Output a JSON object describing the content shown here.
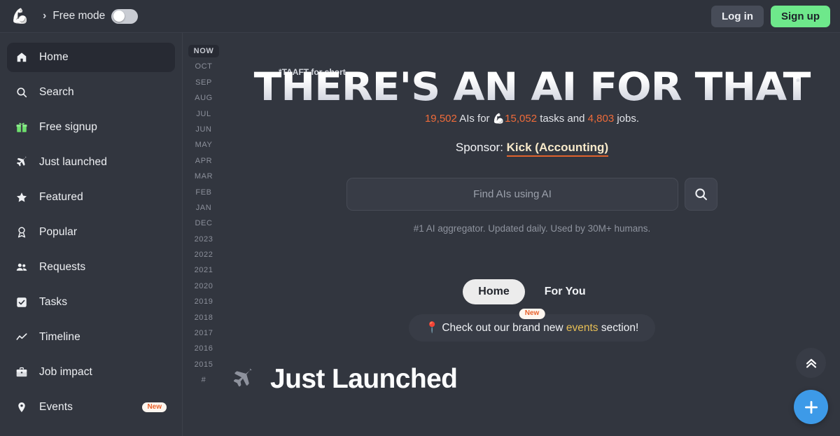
{
  "topbar": {
    "logo_icon": "flexed-biceps-emoji",
    "chevron": "›",
    "free_mode_label": "Free mode",
    "free_mode_on": false,
    "login_label": "Log in",
    "signup_label": "Sign up",
    "signup_color": "#6ee88b"
  },
  "sidebar": {
    "items": [
      {
        "label": "Home",
        "icon": "home-icon",
        "active": true,
        "badge": ""
      },
      {
        "label": "Search",
        "icon": "search-icon",
        "active": false,
        "badge": ""
      },
      {
        "label": "Free signup",
        "icon": "gift-icon",
        "active": false,
        "badge": ""
      },
      {
        "label": "Just launched",
        "icon": "plane-icon",
        "active": false,
        "badge": ""
      },
      {
        "label": "Featured",
        "icon": "star-icon",
        "active": false,
        "badge": ""
      },
      {
        "label": "Popular",
        "icon": "award-ribbon-icon",
        "active": false,
        "badge": ""
      },
      {
        "label": "Requests",
        "icon": "people-icon",
        "active": false,
        "badge": ""
      },
      {
        "label": "Tasks",
        "icon": "checkbox-icon",
        "active": false,
        "badge": ""
      },
      {
        "label": "Timeline",
        "icon": "line-chart-icon",
        "active": false,
        "badge": ""
      },
      {
        "label": "Job impact",
        "icon": "briefcase-icon",
        "active": false,
        "badge": ""
      },
      {
        "label": "Events",
        "icon": "map-pin-icon",
        "active": false,
        "badge": "New"
      }
    ]
  },
  "timeline_rail": {
    "items": [
      "NOW",
      "OCT",
      "SEP",
      "AUG",
      "JUL",
      "JUN",
      "MAY",
      "APR",
      "MAR",
      "FEB",
      "JAN",
      "DEC",
      "2023",
      "2022",
      "2021",
      "2020",
      "2019",
      "2018",
      "2017",
      "2016",
      "2015",
      "#"
    ],
    "selected": "NOW"
  },
  "hero": {
    "footnote": "*TAAFT for short",
    "title": "THERE'S AN AI FOR THAT",
    "title_star": "*",
    "stats": {
      "ais_count": "19,502",
      "ais_mid": "AIs for",
      "tasks_icon": "flexed-biceps-emoji",
      "tasks_count": "15,052",
      "tasks_word": "tasks and",
      "jobs_count": "4,803",
      "jobs_word": "jobs.",
      "accent_color": "#ef6b3a"
    },
    "sponsor_prefix": "Sponsor:",
    "sponsor_name": "Kick (Accounting)",
    "sponsor_underline_color": "#e0622c"
  },
  "search": {
    "value": "",
    "placeholder": "Find AIs using AI",
    "button_icon": "search-icon",
    "subtitle": "#1 AI aggregator. Updated daily. Used by 30M+ humans."
  },
  "tabs": [
    {
      "label": "Home",
      "active": true
    },
    {
      "label": "For You",
      "active": false
    }
  ],
  "event_banner": {
    "badge": "New",
    "pin_icon": "round-pushpin-emoji",
    "text_before": "Check out our brand new",
    "highlight": "events",
    "text_after": "section!",
    "highlight_color": "#e7bf55"
  },
  "section": {
    "icon": "plane-icon",
    "title": "Just Launched"
  },
  "floating": {
    "scroll_top_icon": "double-chevron-up-icon",
    "add_icon": "plus-icon",
    "add_color": "#3d9ae8"
  }
}
